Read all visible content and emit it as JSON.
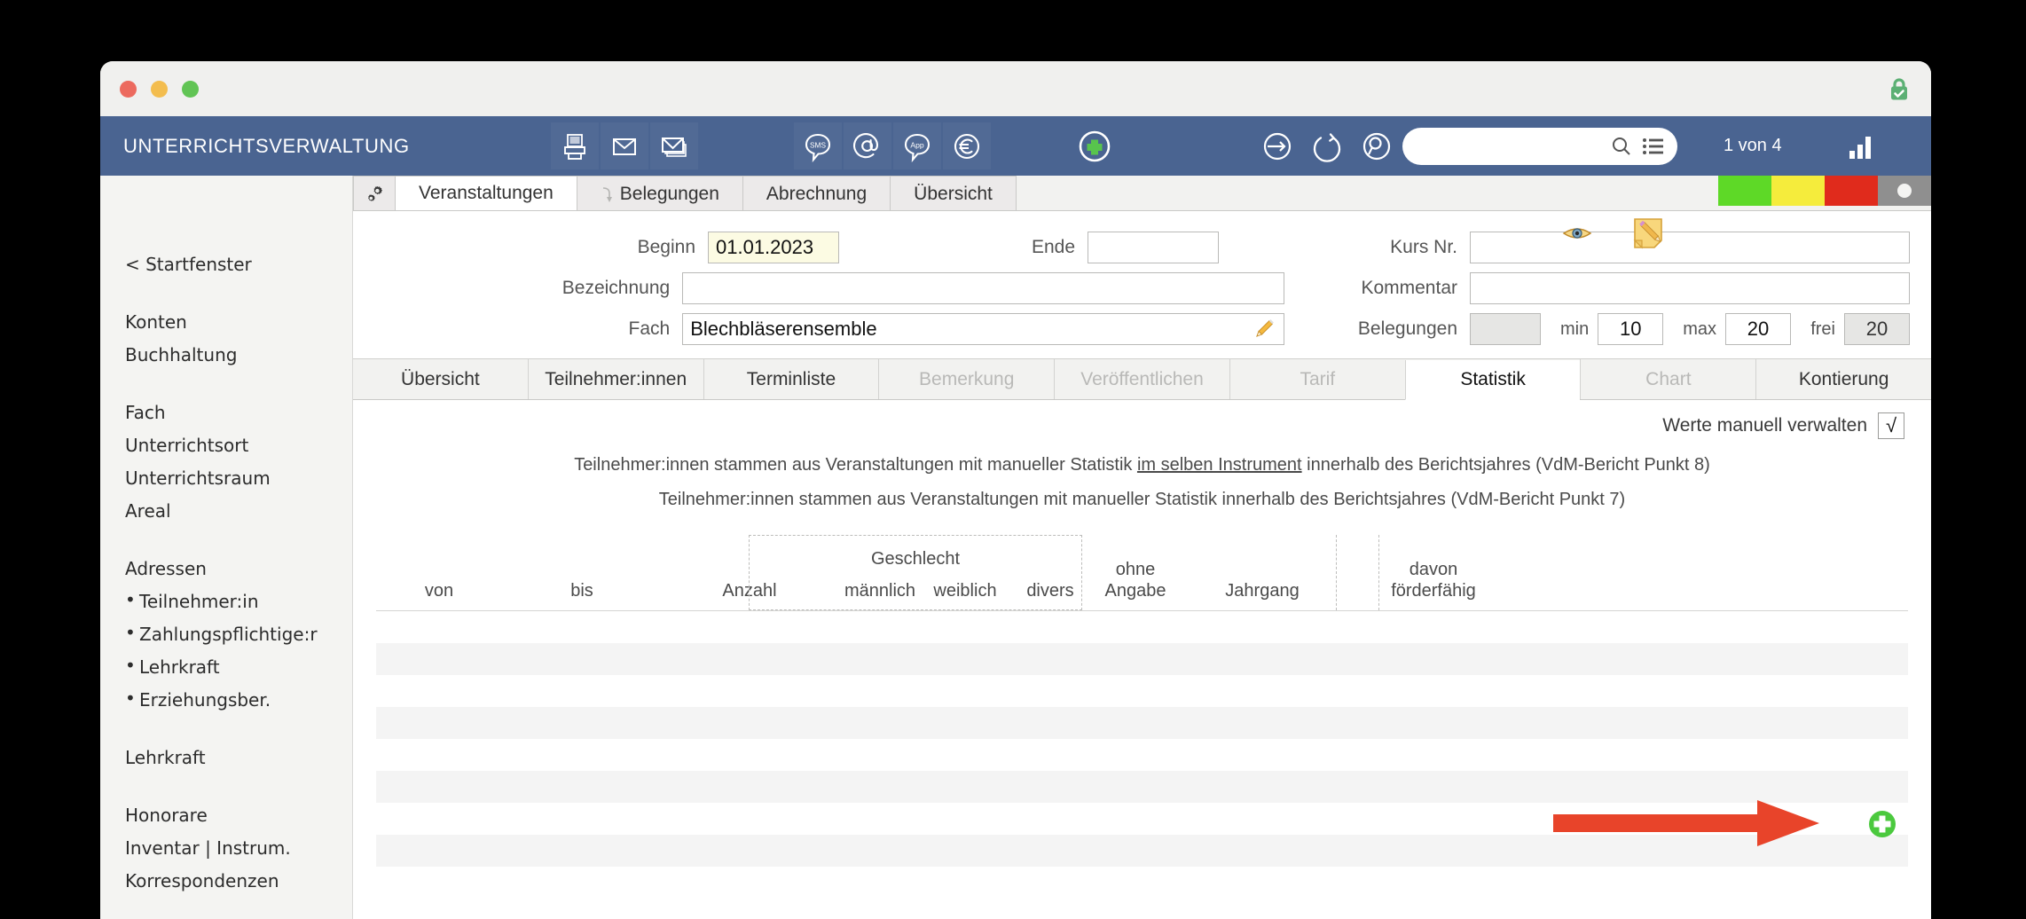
{
  "window": {
    "title": "UNTERRICHTSVERWALTUNG",
    "lock_icon": "lock-secure-icon",
    "traffic_lights": [
      "close",
      "minimize",
      "zoom"
    ]
  },
  "toolbar": {
    "icons_left": [
      "printer-icon",
      "envelope-icon",
      "envelope-stack-icon"
    ],
    "icons_mid": [
      "sms-bubble-icon",
      "at-sign-icon",
      "app-bubble-icon",
      "euro-circle-icon"
    ],
    "add_icon": "plus-circle-icon",
    "icons_right": [
      "arrow-enter-circle-icon",
      "refresh-circle-icon",
      "search-circle-icon"
    ],
    "search_placeholder": "",
    "search_value": "",
    "search_icon": "magnifier-icon",
    "list_icon": "list-icon",
    "record_counter": "1 von 4",
    "chart_icon": "bar-chart-icon"
  },
  "sidebar": {
    "back_link": "< Startfenster",
    "groups": [
      {
        "items": [
          {
            "label": "Konten",
            "bullet": false
          },
          {
            "label": "Buchhaltung",
            "bullet": false
          }
        ]
      },
      {
        "items": [
          {
            "label": "Fach",
            "bullet": false
          },
          {
            "label": "Unterrichtsort",
            "bullet": false
          },
          {
            "label": "Unterrichtsraum",
            "bullet": false
          },
          {
            "label": "Areal",
            "bullet": false
          }
        ]
      },
      {
        "items": [
          {
            "label": "Adressen",
            "bullet": false
          },
          {
            "label": "Teilnehmer:in",
            "bullet": true
          },
          {
            "label": "Zahlungspflichtige:r",
            "bullet": true
          },
          {
            "label": "Lehrkraft",
            "bullet": true
          },
          {
            "label": "Erziehungsber.",
            "bullet": true
          }
        ]
      },
      {
        "items": [
          {
            "label": "Lehrkraft",
            "bullet": false
          }
        ]
      },
      {
        "items": [
          {
            "label": "Honorare",
            "bullet": false
          },
          {
            "label": "Inventar | Instrum.",
            "bullet": false
          },
          {
            "label": "Korrespondenzen",
            "bullet": false
          }
        ]
      }
    ]
  },
  "main_tabs": {
    "gear_icon": "gear-icon",
    "items": [
      {
        "label": "Veranstaltungen",
        "active": true,
        "icon": null
      },
      {
        "label": "Belegungen",
        "active": false,
        "icon": "arrow-hook-icon"
      },
      {
        "label": "Abrechnung",
        "active": false,
        "icon": null
      },
      {
        "label": "Übersicht",
        "active": false,
        "icon": null
      }
    ]
  },
  "form": {
    "beginn_label": "Beginn",
    "beginn_value": "01.01.2023",
    "ende_label": "Ende",
    "ende_value": "",
    "bezeichnung_label": "Bezeichnung",
    "bezeichnung_value": "",
    "fach_label": "Fach",
    "fach_value": "Blechbläserensemble",
    "fach_edit_icon": "pencil-icon",
    "kurs_nr_label": "Kurs Nr.",
    "kurs_nr_value": "",
    "kommentar_label": "Kommentar",
    "kommentar_value": "",
    "belegungen_label": "Belegungen",
    "belegungen_value": "",
    "min_label": "min",
    "min_value": "10",
    "max_label": "max",
    "max_value": "20",
    "frei_label": "frei",
    "frei_value": "20",
    "eye_icon": "eye-icon",
    "note_edit_icon": "note-pencil-icon",
    "status_colors": [
      "#5ed927",
      "#f5ec3c",
      "#e02b1c",
      "#8f8f8f"
    ],
    "status_dot_color": "#f4f4f2"
  },
  "sub_tabs": [
    {
      "label": "Übersicht",
      "state": "enabled"
    },
    {
      "label": "Teilnehmer:innen",
      "state": "enabled"
    },
    {
      "label": "Terminliste",
      "state": "enabled"
    },
    {
      "label": "Bemerkung",
      "state": "disabled"
    },
    {
      "label": "Veröffentlichen",
      "state": "disabled"
    },
    {
      "label": "Tarif",
      "state": "disabled"
    },
    {
      "label": "Statistik",
      "state": "active"
    },
    {
      "label": "Chart",
      "state": "disabled"
    },
    {
      "label": "Kontierung",
      "state": "enabled"
    }
  ],
  "statistik": {
    "manual_label": "Werte manuell verwalten",
    "manual_checked": "√",
    "note_1_part_a": "Teilnehmer:innen stammen aus Veranstaltungen mit manueller Statistik ",
    "note_1_underlined": "im selben Instrument",
    "note_1_part_b": " innerhalb des Berichtsjahres (VdM-Bericht Punkt 8)",
    "note_2": "Teilnehmer:innen stammen aus Veranstaltungen mit manueller Statistik innerhalb des Berichtsjahres (VdM-Bericht Punkt 7)",
    "group_header": "Geschlecht",
    "columns": [
      {
        "key": "von",
        "label": "von"
      },
      {
        "key": "bis",
        "label": "bis"
      },
      {
        "key": "anzahl",
        "label": "Anzahl"
      },
      {
        "key": "maennlich",
        "label": "männlich"
      },
      {
        "key": "weiblich",
        "label": "weiblich"
      },
      {
        "key": "divers",
        "label": "divers"
      },
      {
        "key": "ohne_angabe",
        "label": "ohne\nAngabe"
      },
      {
        "key": "jahrgang",
        "label": "Jahrgang"
      },
      {
        "key": "davon_foerderfaehig",
        "label": "davon\nförderfähig"
      }
    ],
    "rows": [],
    "empty_row_count": 8,
    "add_button_icon": "plus-circle-green-icon",
    "annotation_arrow": {
      "color": "#e8442a",
      "points_to": "add-row-button"
    }
  }
}
